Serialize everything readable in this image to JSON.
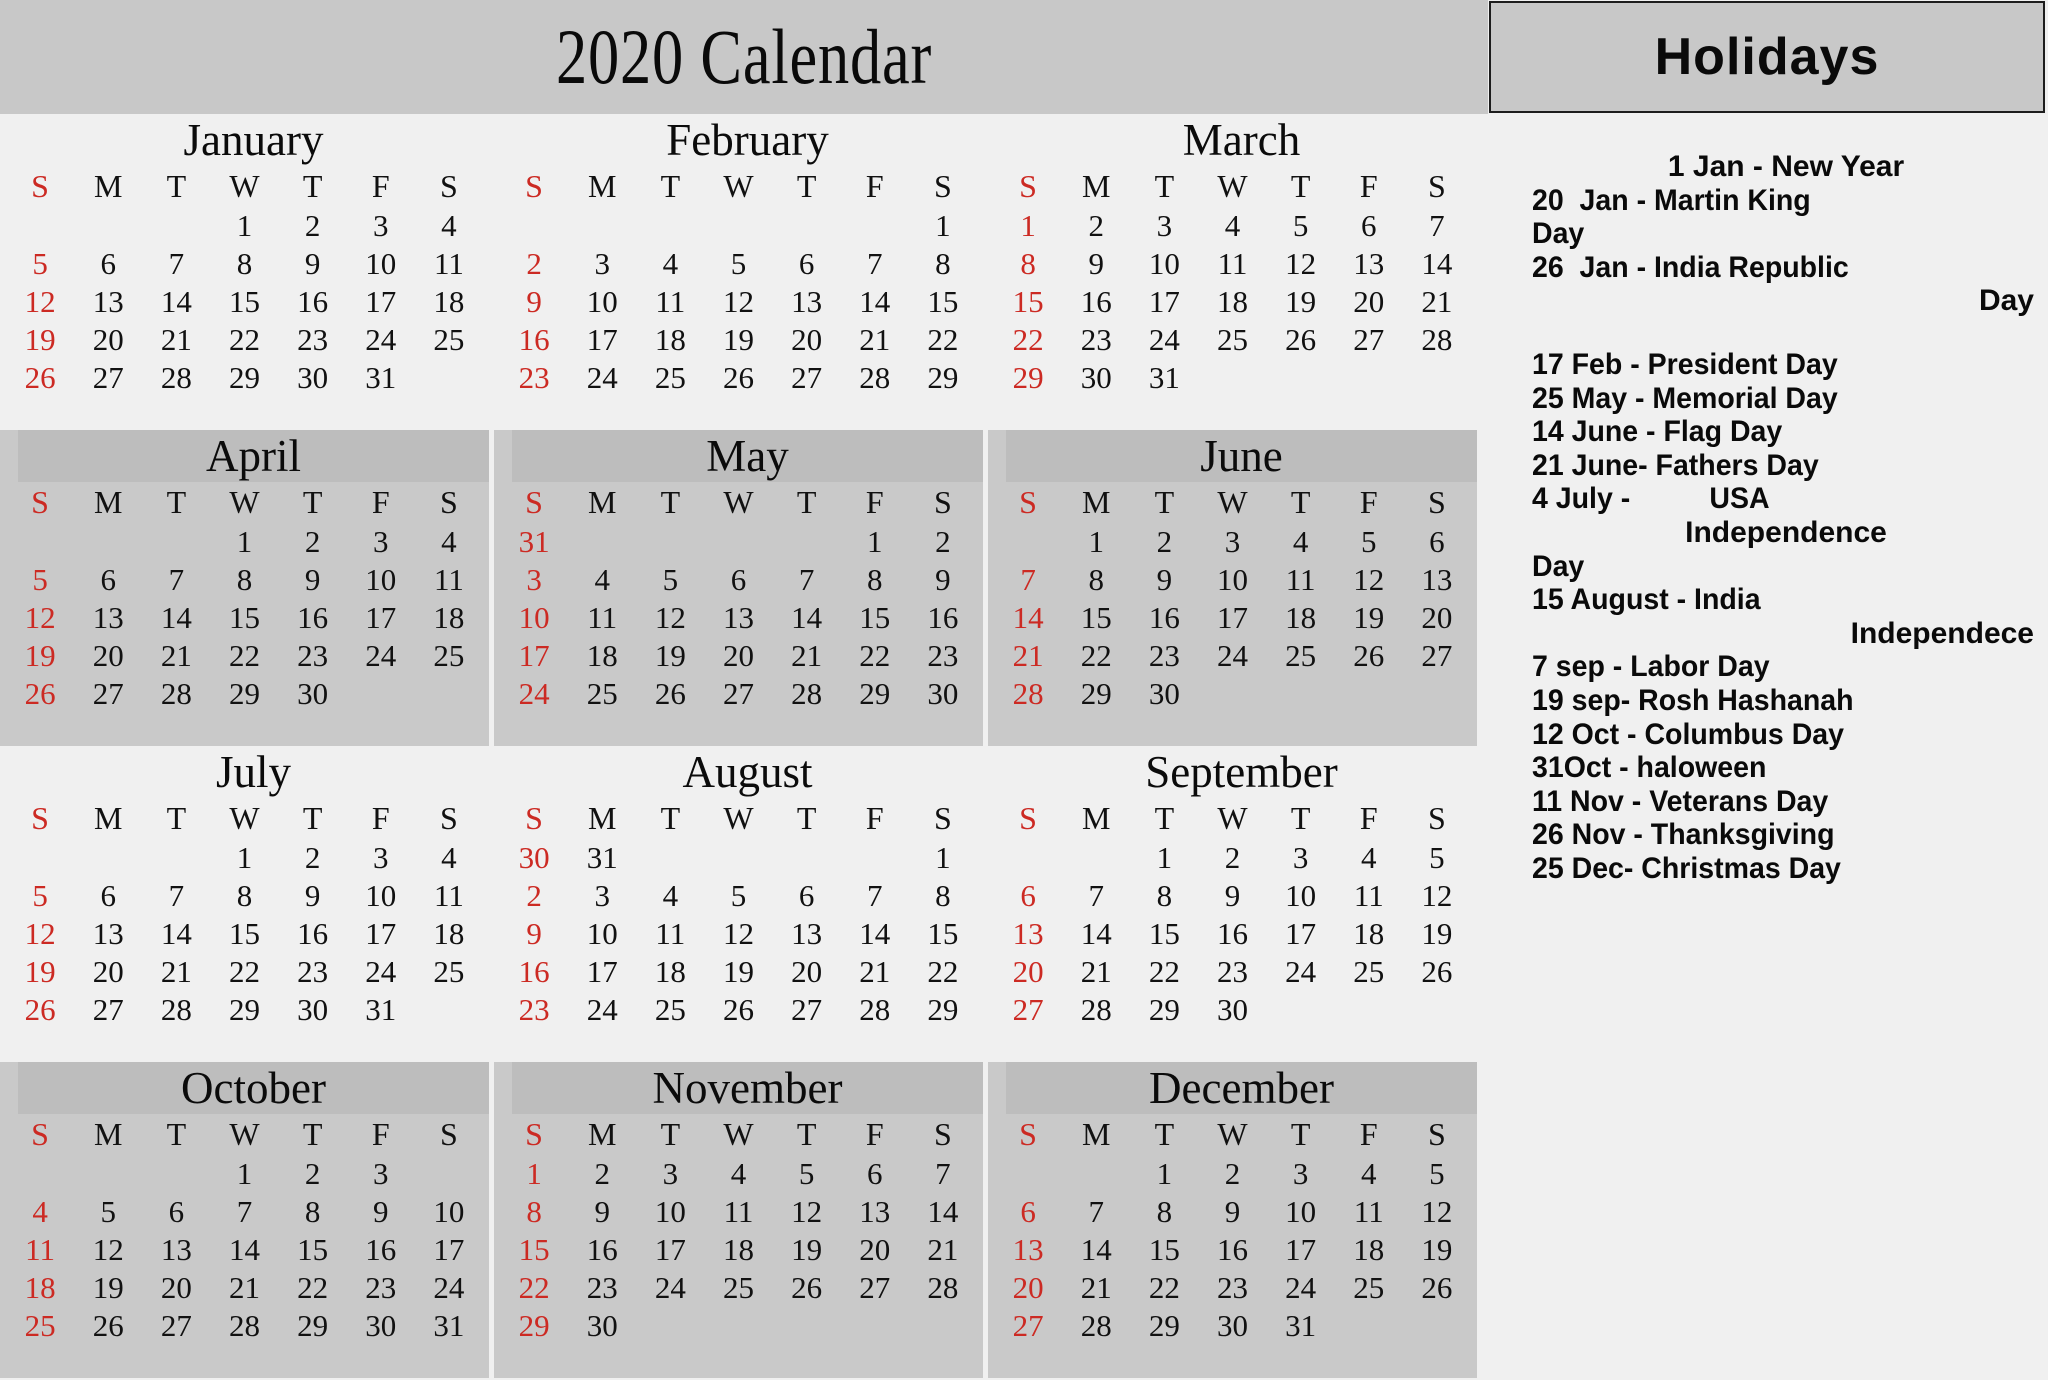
{
  "header": {
    "title": "2020 Calendar",
    "holidays_title": "Holidays"
  },
  "colors": {
    "banner_bg": "#c8c8c8",
    "page_bg": "#f0f0f0",
    "shaded_row_bg": "#c9c9c9",
    "sunday_red": "#cc2a23",
    "text_black": "#0a0a0a"
  },
  "weekday_headers": [
    "S",
    "M",
    "T",
    "W",
    "T",
    "F",
    "S"
  ],
  "months": [
    {
      "name": "January",
      "weeks": [
        [
          "",
          "",
          "",
          "1",
          "2",
          "3",
          "4"
        ],
        [
          "5",
          "6",
          "7",
          "8",
          "9",
          "10",
          "11"
        ],
        [
          "12",
          "13",
          "14",
          "15",
          "16",
          "17",
          "18"
        ],
        [
          "19",
          "20",
          "21",
          "22",
          "23",
          "24",
          "25"
        ],
        [
          "26",
          "27",
          "28",
          "29",
          "30",
          "31",
          ""
        ]
      ]
    },
    {
      "name": "February",
      "weeks": [
        [
          "",
          "",
          "",
          "",
          "",
          "",
          "1"
        ],
        [
          "2",
          "3",
          "4",
          "5",
          "6",
          "7",
          "8"
        ],
        [
          "9",
          "10",
          "11",
          "12",
          "13",
          "14",
          "15"
        ],
        [
          "16",
          "17",
          "18",
          "19",
          "20",
          "21",
          "22"
        ],
        [
          "23",
          "24",
          "25",
          "26",
          "27",
          "28",
          "29"
        ]
      ]
    },
    {
      "name": "March",
      "weeks": [
        [
          "1",
          "2",
          "3",
          "4",
          "5",
          "6",
          "7"
        ],
        [
          "8",
          "9",
          "10",
          "11",
          "12",
          "13",
          "14"
        ],
        [
          "15",
          "16",
          "17",
          "18",
          "19",
          "20",
          "21"
        ],
        [
          "22",
          "23",
          "24",
          "25",
          "26",
          "27",
          "28"
        ],
        [
          "29",
          "30",
          "31",
          "",
          "",
          "",
          ""
        ]
      ]
    },
    {
      "name": "April",
      "weeks": [
        [
          "",
          "",
          "",
          "1",
          "2",
          "3",
          "4"
        ],
        [
          "5",
          "6",
          "7",
          "8",
          "9",
          "10",
          "11"
        ],
        [
          "12",
          "13",
          "14",
          "15",
          "16",
          "17",
          "18"
        ],
        [
          "19",
          "20",
          "21",
          "22",
          "23",
          "24",
          "25"
        ],
        [
          "26",
          "27",
          "28",
          "29",
          "30",
          "",
          ""
        ]
      ]
    },
    {
      "name": "May",
      "weeks": [
        [
          "31",
          "",
          "",
          "",
          "",
          "1",
          "2"
        ],
        [
          "3",
          "4",
          "5",
          "6",
          "7",
          "8",
          "9"
        ],
        [
          "10",
          "11",
          "12",
          "13",
          "14",
          "15",
          "16"
        ],
        [
          "17",
          "18",
          "19",
          "20",
          "21",
          "22",
          "23"
        ],
        [
          "24",
          "25",
          "26",
          "27",
          "28",
          "29",
          "30"
        ]
      ]
    },
    {
      "name": "June",
      "weeks": [
        [
          "",
          "1",
          "2",
          "3",
          "4",
          "5",
          "6"
        ],
        [
          "7",
          "8",
          "9",
          "10",
          "11",
          "12",
          "13"
        ],
        [
          "14",
          "15",
          "16",
          "17",
          "18",
          "19",
          "20"
        ],
        [
          "21",
          "22",
          "23",
          "24",
          "25",
          "26",
          "27"
        ],
        [
          "28",
          "29",
          "30",
          "",
          "",
          "",
          ""
        ]
      ]
    },
    {
      "name": "July",
      "weeks": [
        [
          "",
          "",
          "",
          "1",
          "2",
          "3",
          "4"
        ],
        [
          "5",
          "6",
          "7",
          "8",
          "9",
          "10",
          "11"
        ],
        [
          "12",
          "13",
          "14",
          "15",
          "16",
          "17",
          "18"
        ],
        [
          "19",
          "20",
          "21",
          "22",
          "23",
          "24",
          "25"
        ],
        [
          "26",
          "27",
          "28",
          "29",
          "30",
          "31",
          ""
        ]
      ]
    },
    {
      "name": "August",
      "weeks": [
        [
          "30",
          "31",
          "",
          "",
          "",
          "",
          "1"
        ],
        [
          "2",
          "3",
          "4",
          "5",
          "6",
          "7",
          "8"
        ],
        [
          "9",
          "10",
          "11",
          "12",
          "13",
          "14",
          "15"
        ],
        [
          "16",
          "17",
          "18",
          "19",
          "20",
          "21",
          "22"
        ],
        [
          "23",
          "24",
          "25",
          "26",
          "27",
          "28",
          "29"
        ]
      ]
    },
    {
      "name": "September",
      "weeks": [
        [
          "",
          "",
          "1",
          "2",
          "3",
          "4",
          "5"
        ],
        [
          "6",
          "7",
          "8",
          "9",
          "10",
          "11",
          "12"
        ],
        [
          "13",
          "14",
          "15",
          "16",
          "17",
          "18",
          "19"
        ],
        [
          "20",
          "21",
          "22",
          "23",
          "24",
          "25",
          "26"
        ],
        [
          "27",
          "28",
          "29",
          "30",
          "",
          "",
          ""
        ]
      ]
    },
    {
      "name": "October",
      "weeks": [
        [
          "",
          "",
          "",
          "1",
          "2",
          "3",
          ""
        ],
        [
          "4",
          "5",
          "6",
          "7",
          "8",
          "9",
          "10"
        ],
        [
          "11",
          "12",
          "13",
          "14",
          "15",
          "16",
          "17"
        ],
        [
          "18",
          "19",
          "20",
          "21",
          "22",
          "23",
          "24"
        ],
        [
          "25",
          "26",
          "27",
          "28",
          "29",
          "30",
          "31"
        ]
      ]
    },
    {
      "name": "November",
      "weeks": [
        [
          "1",
          "2",
          "3",
          "4",
          "5",
          "6",
          "7"
        ],
        [
          "8",
          "9",
          "10",
          "11",
          "12",
          "13",
          "14"
        ],
        [
          "15",
          "16",
          "17",
          "18",
          "19",
          "20",
          "21"
        ],
        [
          "22",
          "23",
          "24",
          "25",
          "26",
          "27",
          "28"
        ],
        [
          "29",
          "30",
          "",
          "",
          "",
          "",
          ""
        ]
      ]
    },
    {
      "name": "December",
      "weeks": [
        [
          "",
          "",
          "1",
          "2",
          "3",
          "4",
          "5"
        ],
        [
          "6",
          "7",
          "8",
          "9",
          "10",
          "11",
          "12"
        ],
        [
          "13",
          "14",
          "15",
          "16",
          "17",
          "18",
          "19"
        ],
        [
          "20",
          "21",
          "22",
          "23",
          "24",
          "25",
          "26"
        ],
        [
          "27",
          "28",
          "29",
          "30",
          "31",
          "",
          ""
        ]
      ]
    }
  ],
  "holidays": {
    "group1": {
      "line1": "1 Jan - New Year",
      "line2": "20  Jan - Martin King",
      "line3": "Day",
      "line4": "26  Jan - India Republic",
      "line5": "Day"
    },
    "group2": {
      "line1": "17 Feb - President Day",
      "line2": "25 May - Memorial Day",
      "line3": "14 June - Flag Day",
      "line4": "21 June- Fathers Day",
      "line5": "4 July -          USA",
      "line6": "Independence",
      "line7": "Day",
      "line8": "15 August - India",
      "line9": "Independece",
      "line10": "7 sep - Labor Day",
      "line11": "19 sep- Rosh Hashanah",
      "line12": "12 Oct - Columbus Day",
      "line13": "31Oct - haloween",
      "line14": "11 Nov - Veterans Day",
      "line15": "26 Nov - Thanksgiving",
      "line16": "25 Dec- Christmas Day"
    }
  }
}
